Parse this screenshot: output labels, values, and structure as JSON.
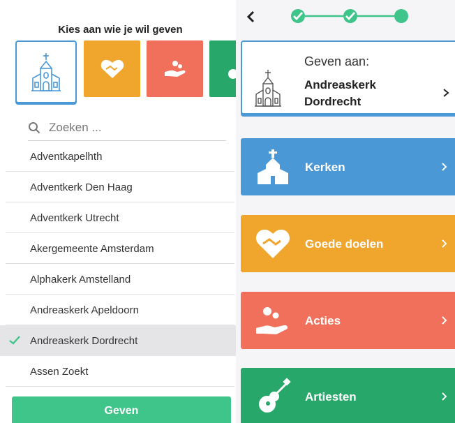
{
  "left": {
    "title": "Kies aan wie je wil geven",
    "search": {
      "placeholder": "Zoeken ..."
    },
    "tiles": [
      {
        "name": "kerken",
        "color": "#ffffff",
        "selected": true,
        "icon": "church-icon"
      },
      {
        "name": "goede-doelen",
        "color": "#f0a52d",
        "selected": false,
        "icon": "heart-handshake-icon"
      },
      {
        "name": "acties",
        "color": "#f0705b",
        "selected": false,
        "icon": "hand-coins-icon"
      },
      {
        "name": "artiesten",
        "color": "#27a86a",
        "selected": false,
        "icon": "guitar-icon"
      }
    ],
    "churches": [
      "Adventkapelhth",
      "Adventkerk Den Haag",
      "Adventkerk Utrecht",
      "Akergemeente Amsterdam",
      "Alphakerk Amstelland",
      "Andreaskerk Apeldoorn",
      "Andreaskerk Dordrecht",
      "Assen Zoekt"
    ],
    "selected_church": "Andreaskerk Dordrecht",
    "submit_label": "Geven"
  },
  "right": {
    "progress": {
      "steps_total": 3,
      "steps_done": 2,
      "current_step": 3
    },
    "summary": {
      "label": "Geven aan:",
      "name_line1": "Andreaskerk",
      "name_line2": "Dordrecht"
    },
    "categories": [
      {
        "label": "Kerken",
        "color": "#4a98d6",
        "icon": "church-icon"
      },
      {
        "label": "Goede doelen",
        "color": "#f0a52d",
        "icon": "heart-handshake-icon"
      },
      {
        "label": "Acties",
        "color": "#f0705b",
        "icon": "hand-coins-icon"
      },
      {
        "label": "Artiesten",
        "color": "#27a86a",
        "icon": "guitar-icon"
      }
    ]
  },
  "colors": {
    "accent_blue": "#4a98d6",
    "green": "#3fc489",
    "orange": "#f0a52d",
    "coral": "#f0705b",
    "dark_green": "#27a86a"
  }
}
